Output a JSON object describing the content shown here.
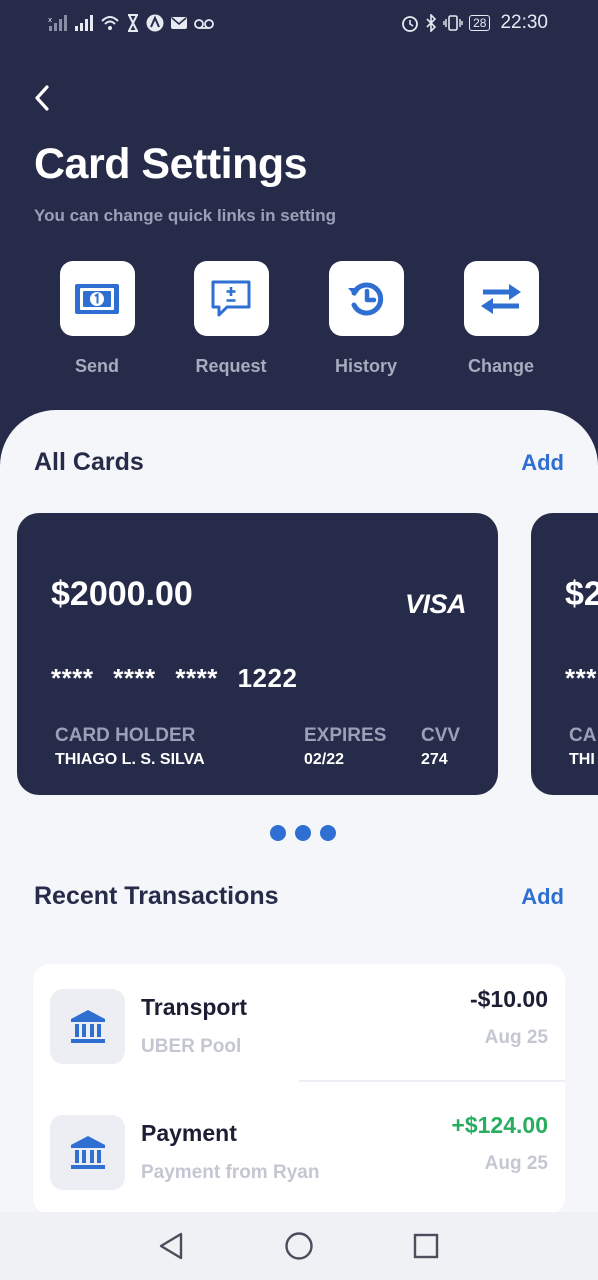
{
  "status_bar": {
    "time": "22:30",
    "battery": "28",
    "left_icons": [
      "no-sim-signal-icon",
      "signal-icon",
      "wifi-icon",
      "hourglass-icon",
      "app-a-icon",
      "mail-icon",
      "voicemail-icon"
    ],
    "right_icons": [
      "alarm-icon",
      "bluetooth-icon",
      "vibrate-icon",
      "battery-icon"
    ]
  },
  "header": {
    "title": "Card Settings",
    "subtitle": "You can change quick links in setting"
  },
  "quick_links": [
    {
      "label": "Send",
      "icon": "banknote-icon"
    },
    {
      "label": "Request",
      "icon": "message-plus-minus-icon"
    },
    {
      "label": "History",
      "icon": "history-icon"
    },
    {
      "label": "Change",
      "icon": "swap-arrows-icon"
    }
  ],
  "cards_section": {
    "title": "All Cards",
    "action": "Add"
  },
  "cards": [
    {
      "balance": "$2000.00",
      "brand": "VISA",
      "number": "****  ****  ****  1222",
      "holder_label": "CARD HOLDER",
      "holder": "THIAGO L. S. SILVA",
      "expires_label": "EXPIRES",
      "expires": "02/22",
      "cvv_label": "CVV",
      "cvv": "274"
    },
    {
      "balance": "$2",
      "number": "***",
      "holder_label": "CA",
      "holder": "THI"
    }
  ],
  "carousel": {
    "dots": 3
  },
  "transactions_section": {
    "title": "Recent Transactions",
    "action": "Add"
  },
  "transactions": [
    {
      "title": "Transport",
      "subtitle": "UBER Pool",
      "amount": "-$10.00",
      "date": "Aug 25",
      "icon": "bank-icon"
    },
    {
      "title": "Payment",
      "subtitle": "Payment from Ryan",
      "amount": "+$124.00",
      "date": "Aug 25",
      "icon": "bank-icon"
    }
  ],
  "colors": {
    "header_bg": "#262b4a",
    "accent": "#2f6fd1",
    "positive": "#27ae60",
    "content_bg": "#f5f6fa"
  },
  "nav": {
    "buttons": [
      "back-triangle-icon",
      "home-circle-icon",
      "recents-square-icon"
    ]
  }
}
